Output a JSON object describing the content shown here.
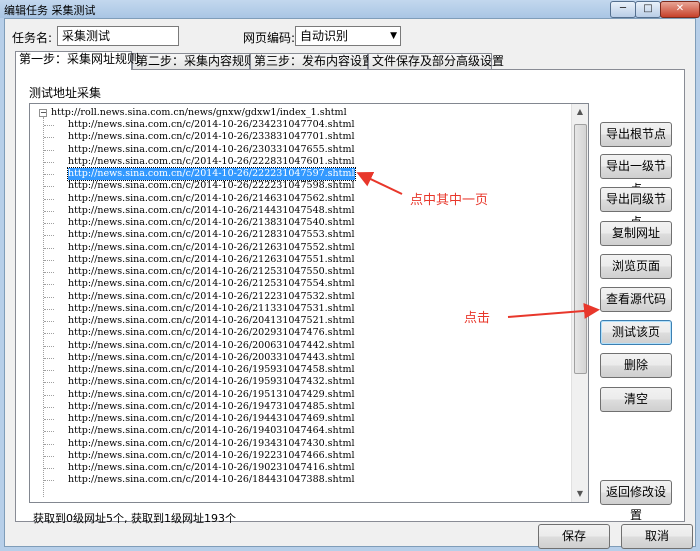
{
  "window": {
    "title": "编辑任务 采集测试",
    "minimize": "─",
    "maximize": "□",
    "close": "✕"
  },
  "header": {
    "task_name_label": "任务名:",
    "task_name_value": "采集测试",
    "encoding_label": "网页编码:",
    "encoding_value": "自动识别"
  },
  "tabs": [
    {
      "label": "第一步：采集网址规则"
    },
    {
      "label": "第二步：采集内容规则"
    },
    {
      "label": "第三步：发布内容设置"
    },
    {
      "label": "文件保存及部分高级设置"
    }
  ],
  "panel": {
    "group_label": "测试地址采集",
    "root_url": "http://roll.news.sina.com.cn/news/gnxw/gdxw1/index_1.shtml",
    "children": [
      "http://news.sina.com.cn/c/2014-10-26/234231047704.shtml",
      "http://news.sina.com.cn/c/2014-10-26/233831047701.shtml",
      "http://news.sina.com.cn/c/2014-10-26/230331047655.shtml",
      "http://news.sina.com.cn/c/2014-10-26/222831047601.shtml",
      "http://news.sina.com.cn/c/2014-10-26/222231047597.shtml",
      "http://news.sina.com.cn/c/2014-10-26/222231047598.shtml",
      "http://news.sina.com.cn/c/2014-10-26/214631047562.shtml",
      "http://news.sina.com.cn/c/2014-10-26/214431047548.shtml",
      "http://news.sina.com.cn/c/2014-10-26/213831047540.shtml",
      "http://news.sina.com.cn/c/2014-10-26/212831047553.shtml",
      "http://news.sina.com.cn/c/2014-10-26/212631047552.shtml",
      "http://news.sina.com.cn/c/2014-10-26/212631047551.shtml",
      "http://news.sina.com.cn/c/2014-10-26/212531047550.shtml",
      "http://news.sina.com.cn/c/2014-10-26/212531047554.shtml",
      "http://news.sina.com.cn/c/2014-10-26/212231047532.shtml",
      "http://news.sina.com.cn/c/2014-10-26/211331047531.shtml",
      "http://news.sina.com.cn/c/2014-10-26/204131047521.shtml",
      "http://news.sina.com.cn/c/2014-10-26/202931047476.shtml",
      "http://news.sina.com.cn/c/2014-10-26/200631047442.shtml",
      "http://news.sina.com.cn/c/2014-10-26/200331047443.shtml",
      "http://news.sina.com.cn/c/2014-10-26/195931047458.shtml",
      "http://news.sina.com.cn/c/2014-10-26/195931047432.shtml",
      "http://news.sina.com.cn/c/2014-10-26/195131047429.shtml",
      "http://news.sina.com.cn/c/2014-10-26/194731047485.shtml",
      "http://news.sina.com.cn/c/2014-10-26/194431047469.shtml",
      "http://news.sina.com.cn/c/2014-10-26/194031047464.shtml",
      "http://news.sina.com.cn/c/2014-10-26/193431047430.shtml",
      "http://news.sina.com.cn/c/2014-10-26/192231047466.shtml",
      "http://news.sina.com.cn/c/2014-10-26/190231047416.shtml",
      "http://news.sina.com.cn/c/2014-10-26/184431047388.shtml"
    ],
    "selected_index": 4,
    "status": "获取到0级网址5个, 获取到1级网址193个"
  },
  "side_buttons": [
    {
      "label": "导出根节点"
    },
    {
      "label": "导出一级节点"
    },
    {
      "label": "导出同级节点"
    },
    {
      "label": "复制网址"
    },
    {
      "label": "浏览页面"
    },
    {
      "label": "查看源代码"
    },
    {
      "label": "测试该页"
    },
    {
      "label": "删除"
    },
    {
      "label": "清空"
    },
    {
      "label": "返回修改设置"
    }
  ],
  "annotations": {
    "select_hint": "点中其中一页",
    "click_hint": "点击",
    "color": "#e8372b"
  },
  "footer": {
    "save_label": "保存",
    "cancel_label": "取消"
  }
}
